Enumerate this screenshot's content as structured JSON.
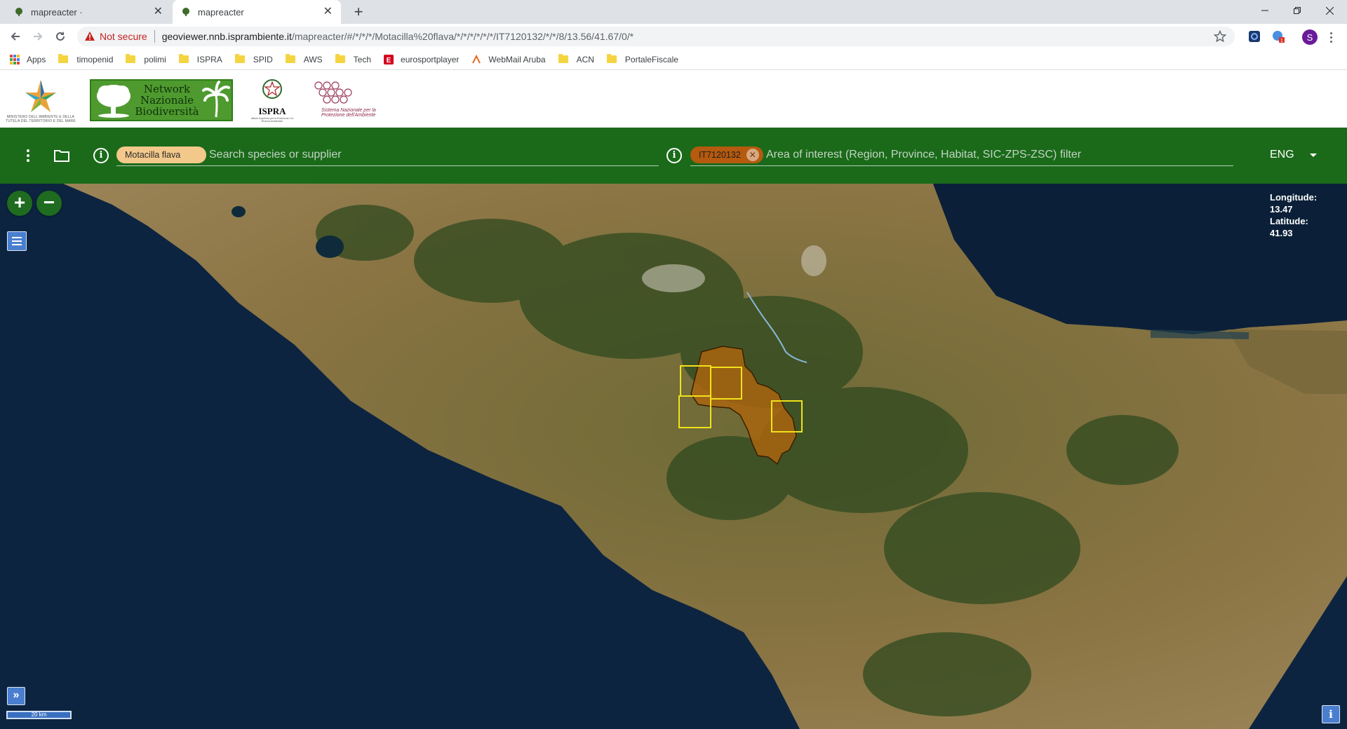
{
  "browser": {
    "tabs": [
      {
        "title": "mapreacter ·",
        "active": false
      },
      {
        "title": "mapreacter",
        "active": true
      }
    ],
    "not_secure_label": "Not secure",
    "url_host": "geoviewer.nnb.isprambiente.it",
    "url_path": "/mapreacter/#/*/*/*/Motacilla%20flava/*/*/*/*/*/*/IT7120132/*/*/8/13.56/41.67/0/*",
    "profile_initial": "S",
    "bookmarks": [
      {
        "label": "Apps",
        "icon": "apps-grid-icon"
      },
      {
        "label": "timopenid",
        "icon": "folder-icon"
      },
      {
        "label": "polimi",
        "icon": "folder-icon"
      },
      {
        "label": "ISPRA",
        "icon": "folder-icon"
      },
      {
        "label": "SPID",
        "icon": "folder-icon"
      },
      {
        "label": "AWS",
        "icon": "folder-icon"
      },
      {
        "label": "Tech",
        "icon": "folder-icon"
      },
      {
        "label": "eurosportplayer",
        "icon": "eurosport-icon"
      },
      {
        "label": "WebMail Aruba",
        "icon": "aruba-icon"
      },
      {
        "label": "ACN",
        "icon": "folder-icon"
      },
      {
        "label": "PortaleFiscale",
        "icon": "folder-icon"
      }
    ]
  },
  "header": {
    "mite_text": "MINISTERO DELL'AMBIENTE E DELLA TUTELA DEL TERRITORIO E DEL MARE",
    "nnb_text": "Network Nazionale Biodiversità",
    "ispra_word": "ISPRA",
    "ispra_small": "Istituto Superiore per la Protezione e la Ricerca Ambientale",
    "snpa_text": "Sistema Nazionale per la Protezione dell'Ambiente"
  },
  "appbar": {
    "species_chip": "Motacilla flava",
    "species_placeholder": "Search species or supplier",
    "area_chip": "IT7120132",
    "area_placeholder": "Area of interest (Region, Province, Habitat, SIC-ZPS-ZSC) filter",
    "language": "ENG"
  },
  "map": {
    "zoom_in": "+",
    "zoom_out": "−",
    "longitude_label": "Longitude:",
    "longitude_value": "13.47",
    "latitude_label": "Latitude:",
    "latitude_value": "41.93",
    "scale_label": "20 km",
    "expand_label": "»",
    "info_label": "i",
    "colors": {
      "sea": "#0d2440",
      "land": "#7a6a3c",
      "forest": "#2f4a1f",
      "area_fill": "#a8650f",
      "grid_stroke": "#f2e21a"
    }
  }
}
